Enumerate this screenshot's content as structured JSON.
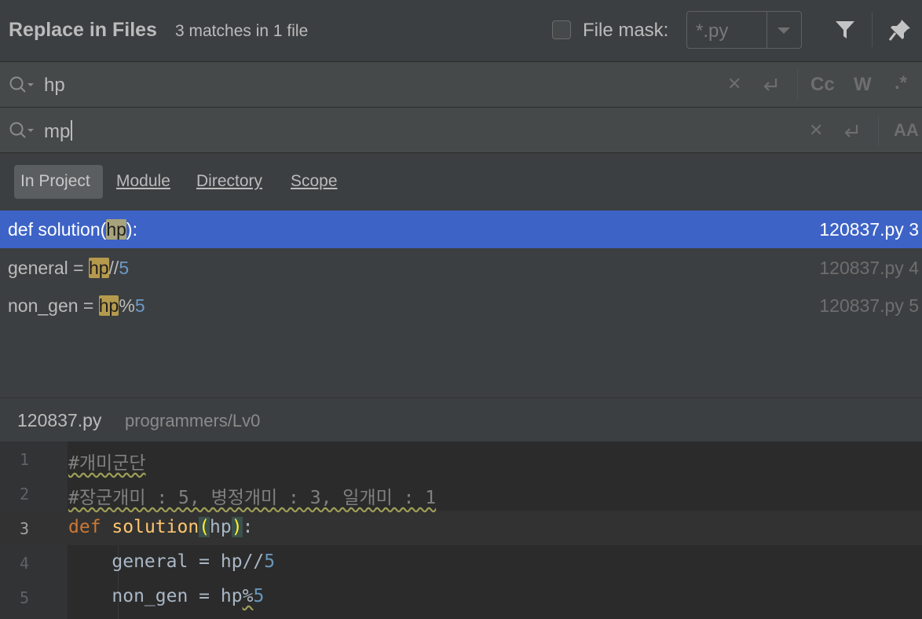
{
  "header": {
    "title": "Replace in Files",
    "match_summary": "3 matches in 1 file",
    "file_mask_label": "File mask:",
    "file_mask_value": "*.py"
  },
  "search": {
    "query": "hp",
    "options": {
      "match_case": "Cc",
      "words": "W",
      "regex": ".*"
    }
  },
  "replace": {
    "value": "mp",
    "preserve_case": "AA"
  },
  "scopes": [
    {
      "label": "In Project",
      "active": true
    },
    {
      "label": "Module",
      "active": false
    },
    {
      "label": "Directory",
      "active": false
    },
    {
      "label": "Scope",
      "active": false
    }
  ],
  "results": [
    {
      "pre": "def solution(",
      "match": "hp",
      "post": "):",
      "num": "",
      "file": "120837.py 3",
      "selected": true
    },
    {
      "pre": "general = ",
      "match": "hp",
      "post": "//",
      "num": "5",
      "file": "120837.py 4",
      "selected": false
    },
    {
      "pre": "non_gen = ",
      "match": "hp",
      "post": "%",
      "num": "5",
      "file": "120837.py 5",
      "selected": false
    }
  ],
  "preview": {
    "file": "120837.py",
    "path": "programmers/Lv0",
    "lines": [
      {
        "n": "1",
        "comment": "#개미군단"
      },
      {
        "n": "2",
        "comment": "#장군개미 : 5, 병정개미 : 3, 일개미 : 1"
      },
      {
        "n": "3",
        "kw": "def",
        "fn": "solution",
        "lp": "(",
        "param": "hp",
        "rp": ")",
        "colon": ":"
      },
      {
        "n": "4",
        "indent": "    ",
        "lhs": "general = ",
        "var": "hp",
        "op": "//",
        "num": "5"
      },
      {
        "n": "5",
        "indent": "    ",
        "lhs": "non_gen = ",
        "var": "hp",
        "op": "%",
        "num": "5"
      }
    ]
  },
  "icons": {
    "search": "search-icon",
    "clear": "clear-icon",
    "newline": "newline-icon",
    "filter": "filter-icon",
    "pin": "pin-icon"
  },
  "colors": {
    "selection": "#3d63c7",
    "match_highlight": "#b59a4d",
    "keyword": "#cc7832",
    "function": "#ffc66d",
    "number": "#6897bb"
  }
}
